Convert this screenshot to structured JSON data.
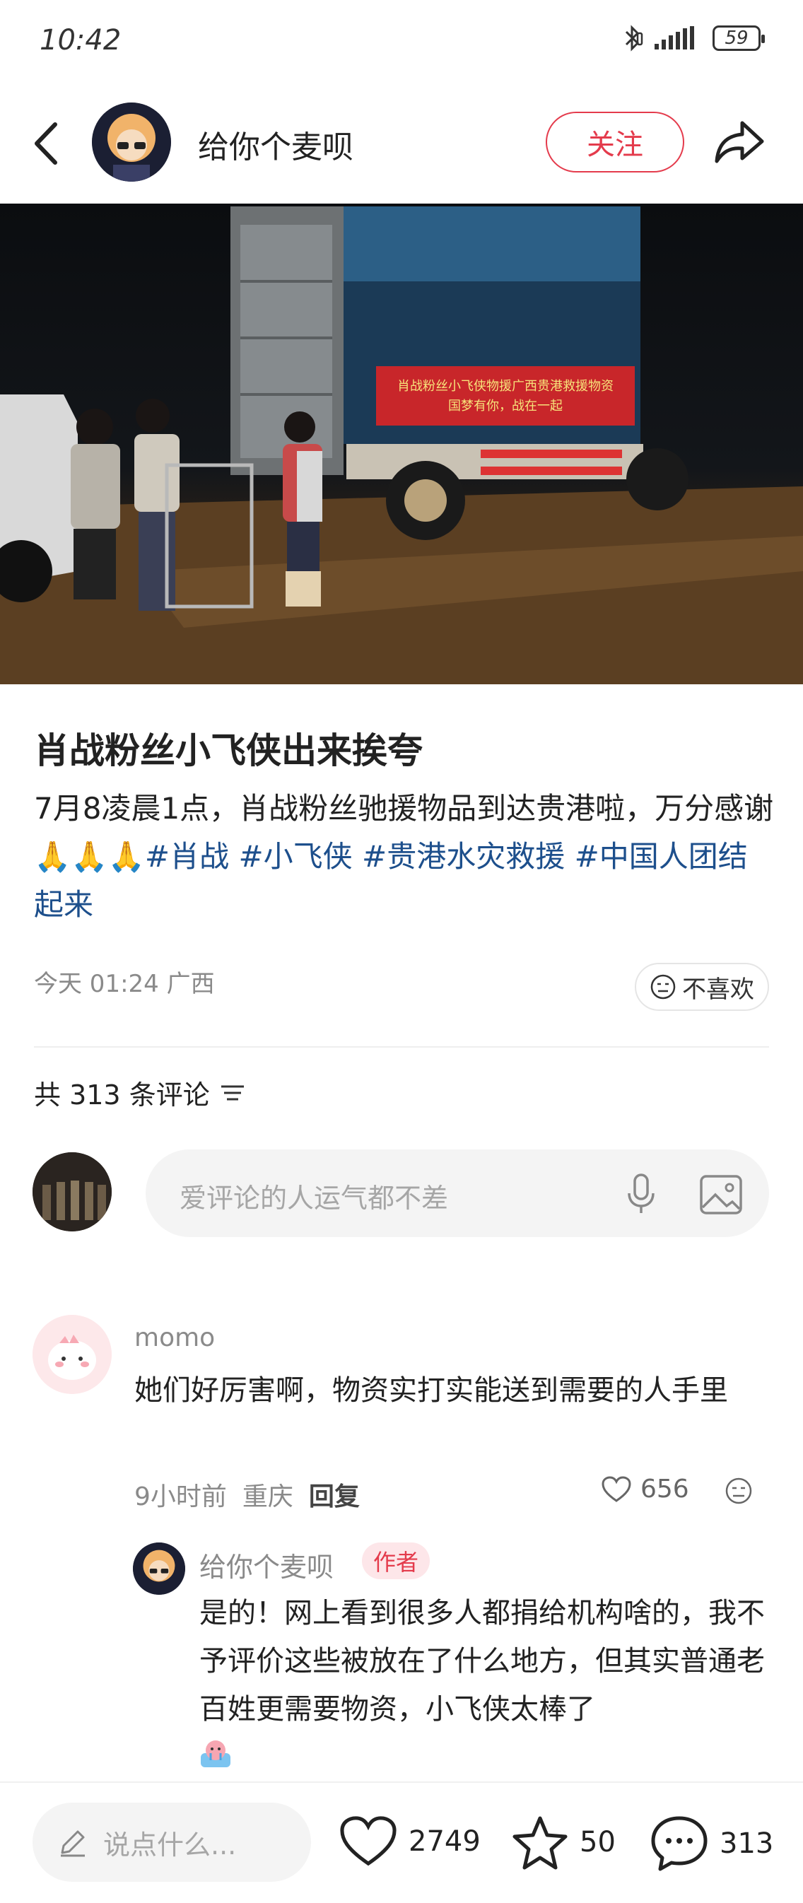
{
  "status_bar": {
    "time": "10:42",
    "battery": "59"
  },
  "header": {
    "author_name": "给你个麦呗",
    "follow_label": "关注"
  },
  "post": {
    "photo_banner_text": "肖战粉丝小飞侠物援广西贵港救援物资 国梦有你，战在一起",
    "title": "肖战粉丝小飞侠出来挨夸",
    "body_text": "7月8凌晨1点，肖战粉丝驰援物品到达贵港啦，万分感谢🙏🙏🙏",
    "tags": [
      "#肖战",
      "#小飞侠",
      "#贵港水灾救援",
      "#中国人团结起来"
    ],
    "date": "今天 01:24",
    "location": "广西",
    "dislike_label": "不喜欢"
  },
  "comments_section": {
    "count_text": "共 313 条评论",
    "input_placeholder": "爱评论的人运气都不差"
  },
  "comment": {
    "username": "momo",
    "text": "她们好厉害啊，物资实打实能送到需要的人手里",
    "time": "9小时前",
    "location": "重庆",
    "reply_label": "回复",
    "likes": "656"
  },
  "reply": {
    "username": "给你个麦呗",
    "badge": "作者",
    "text": "是的！网上看到很多人都捐给机构啥的，我不予评价这些被放在了什么地方，但其实普通老百姓更需要物资，小飞侠太棒了"
  },
  "bottom_bar": {
    "input_placeholder": "说点什么...",
    "likes": "2749",
    "favorites": "50",
    "comments": "313"
  }
}
